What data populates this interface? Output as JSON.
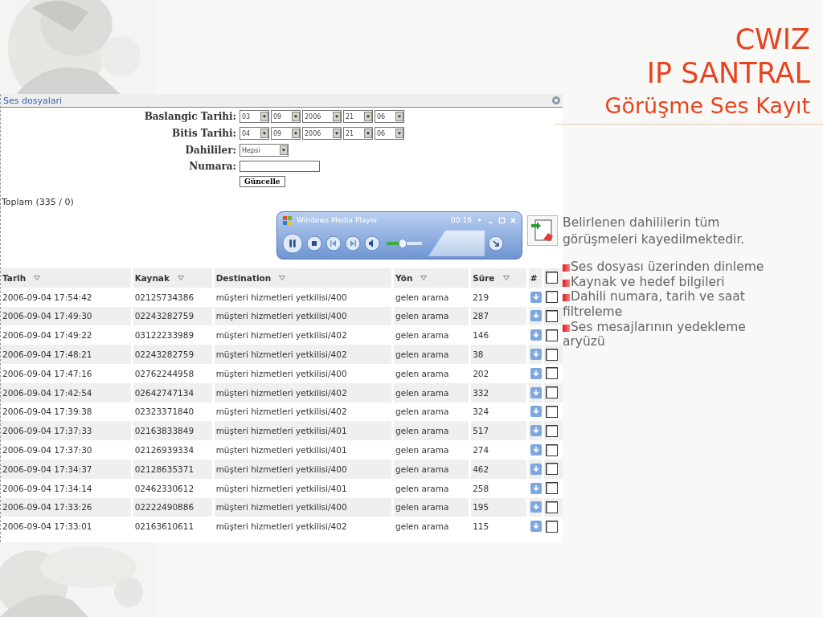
{
  "slide": {
    "title_lines": [
      "CWIZ",
      "IP SANTRAL"
    ],
    "subtitle": "Görüşme Ses Kayıt",
    "description": "Belirlenen dahililerin tüm görüşmeleri kayedilmektedir.",
    "bullets": [
      "Ses dosyası üzerinden dinleme",
      "Kaynak ve hedef bilgileri",
      "Dahili numara, tarih ve saat filtreleme",
      "Ses mesajlarının yedekleme aryüzü"
    ]
  },
  "panel": {
    "title": "Ses dosyalari"
  },
  "filters": [
    {
      "label": "Baslangic Tarihi:",
      "kind": "date",
      "selects": [
        "03",
        "09",
        "2006",
        "21",
        "06"
      ]
    },
    {
      "label": "Bitis Tarihi:",
      "kind": "date",
      "selects": [
        "04",
        "09",
        "2006",
        "21",
        "06"
      ]
    },
    {
      "label": "Dahililer:",
      "kind": "select",
      "value": "Hepsi"
    },
    {
      "label": "Numara:",
      "kind": "text"
    }
  ],
  "update_button": "Güncelle",
  "total": "Toplam (335 / 0)",
  "player": {
    "title": "Windows Media Player",
    "time": "00:16",
    "volume": {
      "level": 0.45
    }
  },
  "table": {
    "columns": [
      "Tarih",
      "Kaynak",
      "Destination",
      "Yön",
      "Süre",
      "#"
    ],
    "select_all_checked": false,
    "rows": [
      {
        "cells": [
          "2006-09-04 17:54:42",
          "02125734386",
          "müşteri hizmetleri yetkilisi/400",
          "gelen arama",
          "219"
        ],
        "checked": false
      },
      {
        "cells": [
          "2006-09-04 17:49:30",
          "02243282759",
          "müşteri hizmetleri yetkilisi/400",
          "gelen arama",
          "287"
        ],
        "checked": false
      },
      {
        "cells": [
          "2006-09-04 17:49:22",
          "03122233989",
          "müşteri hizmetleri yetkilisi/402",
          "gelen arama",
          "146"
        ],
        "checked": false
      },
      {
        "cells": [
          "2006-09-04 17:48:21",
          "02243282759",
          "müşteri hizmetleri yetkilisi/402",
          "gelen arama",
          "38"
        ],
        "checked": false
      },
      {
        "cells": [
          "2006-09-04 17:47:16",
          "02762244958",
          "müşteri hizmetleri yetkilisi/400",
          "gelen arama",
          "202"
        ],
        "checked": false
      },
      {
        "cells": [
          "2006-09-04 17:42:54",
          "02642747134",
          "müşteri hizmetleri yetkilisi/402",
          "gelen arama",
          "332"
        ],
        "checked": false
      },
      {
        "cells": [
          "2006-09-04 17:39:38",
          "02323371840",
          "müşteri hizmetleri yetkilisi/402",
          "gelen arama",
          "324"
        ],
        "checked": false
      },
      {
        "cells": [
          "2006-09-04 17:37:33",
          "02163833849",
          "müşteri hizmetleri yetkilisi/401",
          "gelen arama",
          "517"
        ],
        "checked": false
      },
      {
        "cells": [
          "2006-09-04 17:37:30",
          "02126939334",
          "müşteri hizmetleri yetkilisi/401",
          "gelen arama",
          "274"
        ],
        "checked": false
      },
      {
        "cells": [
          "2006-09-04 17:34:37",
          "02128635371",
          "müşteri hizmetleri yetkilisi/400",
          "gelen arama",
          "462"
        ],
        "checked": false
      },
      {
        "cells": [
          "2006-09-04 17:34:14",
          "02462330612",
          "müşteri hizmetleri yetkilisi/401",
          "gelen arama",
          "258"
        ],
        "checked": false
      },
      {
        "cells": [
          "2006-09-04 17:33:26",
          "02222490886",
          "müşteri hizmetleri yetkilisi/400",
          "gelen arama",
          "195"
        ],
        "checked": false
      },
      {
        "cells": [
          "2006-09-04 17:33:01",
          "02163610611",
          "müşteri hizmetleri yetkilisi/402",
          "gelen arama",
          "115"
        ],
        "checked": false
      }
    ]
  }
}
